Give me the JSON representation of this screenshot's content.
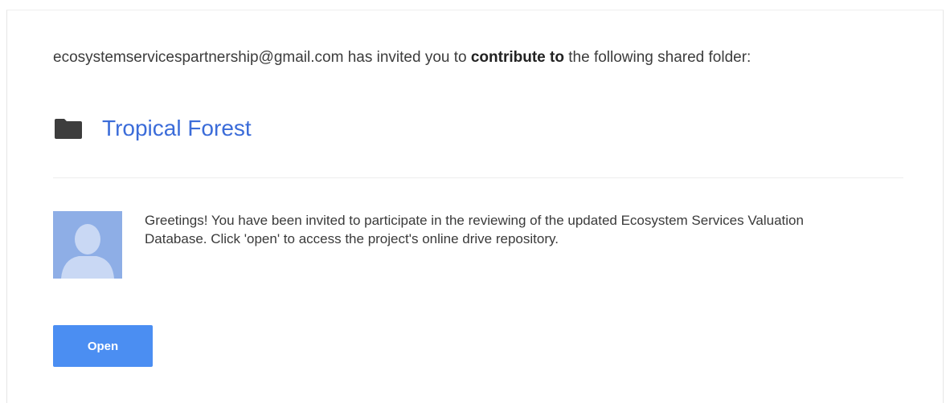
{
  "invite": {
    "sender": "ecosystemservicespartnership@gmail.com",
    "text_before": " has invited you to ",
    "permission": "contribute to",
    "text_after": " the following shared folder:"
  },
  "folder": {
    "icon": "folder-icon",
    "name": "Tropical Forest",
    "link_color": "#3b6cd9"
  },
  "message": {
    "avatar_icon": "default-avatar-icon",
    "text": "Greetings! You have been invited to participate in the reviewing of the updated Ecosystem Services Valuation Database. Click 'open' to access the project's online drive repository."
  },
  "actions": {
    "open_label": "Open",
    "button_color": "#4b8ef2"
  }
}
